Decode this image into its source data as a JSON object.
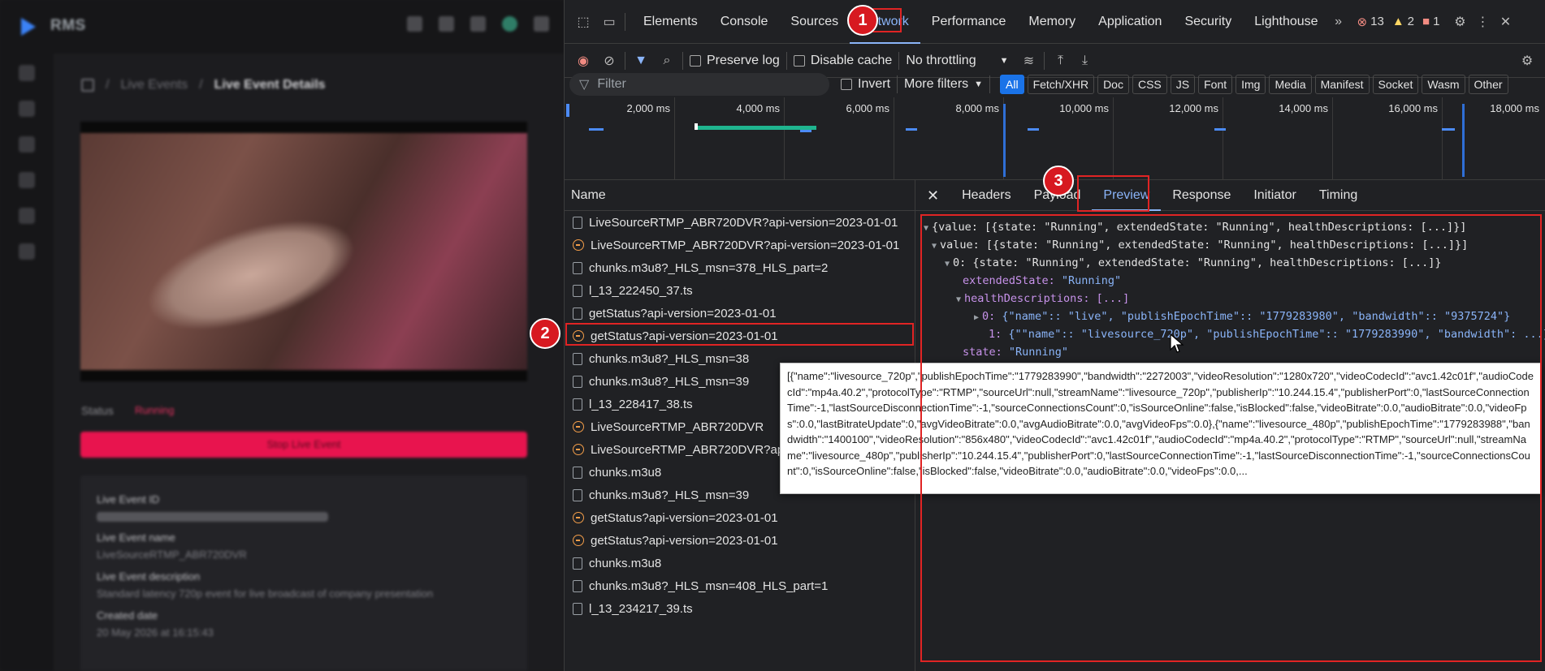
{
  "app": {
    "logo_text": "RMS",
    "breadcrumb": {
      "parent": "Live Events",
      "current": "Live Event Details"
    },
    "status_label": "Status",
    "status_value": "Running",
    "stop_button": "Stop Live Event",
    "details": {
      "id_label": "Live Event ID",
      "name_label": "Live Event name",
      "name_value": "LiveSourceRTMP_ABR720DVR",
      "description_label": "Live Event description",
      "description_value": "Standard latency 720p event for live broadcast of company presentation",
      "created_label": "Created date",
      "created_value": "20 May 2026 at 16:15:43"
    }
  },
  "devtools": {
    "tabs": [
      "Elements",
      "Console",
      "Sources",
      "Network",
      "Performance",
      "Memory",
      "Application",
      "Security",
      "Lighthouse"
    ],
    "active_tab": "Network",
    "counts": {
      "errors": "13",
      "warnings": "2",
      "info": "1"
    },
    "toolbar": {
      "preserve_log": "Preserve log",
      "disable_cache": "Disable cache",
      "throttling": "No throttling"
    },
    "filter": {
      "placeholder": "Filter",
      "invert": "Invert",
      "more_filters": "More filters",
      "types": [
        "All",
        "Fetch/XHR",
        "Doc",
        "CSS",
        "JS",
        "Font",
        "Img",
        "Media",
        "Manifest",
        "Socket",
        "Wasm",
        "Other"
      ]
    },
    "timeline_ticks": [
      "2,000 ms",
      "4,000 ms",
      "6,000 ms",
      "8,000 ms",
      "10,000 ms",
      "12,000 ms",
      "14,000 ms",
      "16,000 ms",
      "18,000 ms"
    ],
    "request_list_header": "Name",
    "requests": [
      {
        "name": "LiveSourceRTMP_ABR720DVR?api-version=2023-01-01",
        "kind": "doc"
      },
      {
        "name": "LiveSourceRTMP_ABR720DVR?api-version=2023-01-01",
        "kind": "xhr"
      },
      {
        "name": "chunks.m3u8?_HLS_msn=378_HLS_part=2",
        "kind": "doc"
      },
      {
        "name": "l_13_222450_37.ts",
        "kind": "doc"
      },
      {
        "name": "getStatus?api-version=2023-01-01",
        "kind": "doc"
      },
      {
        "name": "getStatus?api-version=2023-01-01",
        "kind": "xhr"
      },
      {
        "name": "chunks.m3u8?_HLS_msn=38",
        "kind": "doc"
      },
      {
        "name": "chunks.m3u8?_HLS_msn=39",
        "kind": "doc"
      },
      {
        "name": "l_13_228417_38.ts",
        "kind": "doc"
      },
      {
        "name": "LiveSourceRTMP_ABR720DVR",
        "kind": "xhr"
      },
      {
        "name": "LiveSourceRTMP_ABR720DVR?api",
        "kind": "xhr"
      },
      {
        "name": "chunks.m3u8",
        "kind": "doc"
      },
      {
        "name": "chunks.m3u8?_HLS_msn=39",
        "kind": "doc"
      },
      {
        "name": "getStatus?api-version=2023-01-01",
        "kind": "xhr"
      },
      {
        "name": "getStatus?api-version=2023-01-01",
        "kind": "xhr"
      },
      {
        "name": "chunks.m3u8",
        "kind": "doc"
      },
      {
        "name": "chunks.m3u8?_HLS_msn=408_HLS_part=1",
        "kind": "doc"
      },
      {
        "name": "l_13_234217_39.ts",
        "kind": "doc"
      }
    ],
    "detail_tabs": [
      "Headers",
      "Payload",
      "Preview",
      "Response",
      "Initiator",
      "Timing"
    ],
    "active_detail_tab": "Preview",
    "preview_lines": {
      "l1": "{value: [{state: \"Running\", extendedState: \"Running\", healthDescriptions: [...]}]",
      "l2": "value: [{state: \"Running\", extendedState: \"Running\", healthDescriptions: [...]}]",
      "l3": "0: {state: \"Running\", extendedState: \"Running\", healthDescriptions: [...]}",
      "l4_key": "extendedState: ",
      "l4_val": "\"Running\"",
      "l5": "healthDescriptions: [...]",
      "l6_idx": "0: ",
      "l6_body": "{\"name\":: \"live\", \"publishEpochTime\":: \"1779283980\", \"bandwidth\":: \"9375724\"}",
      "l7_idx": "1: ",
      "l7_body": "{\"\"name\":: \"livesource_720p\", \"publishEpochTime\":: \"1779283990\", \"bandwidth\": ...}",
      "l8_key": "state: ",
      "l8_val": "\"Running\""
    },
    "tooltip": "[{\"name\":\"livesource_720p\",\"publishEpochTime\":\"1779283990\",\"bandwidth\":\"2272003\",\"videoResolution\":\"1280x720\",\"videoCodecId\":\"avc1.42c01f\",\"audioCodecId\":\"mp4a.40.2\",\"protocolType\":\"RTMP\",\"sourceUrl\":null,\"streamName\":\"livesource_720p\",\"publisherIp\":\"10.244.15.4\",\"publisherPort\":0,\"lastSourceConnectionTime\":-1,\"lastSourceDisconnectionTime\":-1,\"sourceConnectionsCount\":0,\"isSourceOnline\":false,\"isBlocked\":false,\"videoBitrate\":0.0,\"audioBitrate\":0.0,\"videoFps\":0.0,\"lastBitrateUpdate\":0,\"avgVideoBitrate\":0.0,\"avgAudioBitrate\":0.0,\"avgVideoFps\":0.0},{\"name\":\"livesource_480p\",\"publishEpochTime\":\"1779283988\",\"bandwidth\":\"1400100\",\"videoResolution\":\"856x480\",\"videoCodecId\":\"avc1.42c01f\",\"audioCodecId\":\"mp4a.40.2\",\"protocolType\":\"RTMP\",\"sourceUrl\":null,\"streamName\":\"livesource_480p\",\"publisherIp\":\"10.244.15.4\",\"publisherPort\":0,\"lastSourceConnectionTime\":-1,\"lastSourceDisconnectionTime\":-1,\"sourceConnectionsCount\":0,\"isSourceOnline\":false,\"isBlocked\":false,\"videoBitrate\":0.0,\"audioBitrate\":0.0,\"videoFps\":0.0,...",
    "annotations": [
      "1",
      "2",
      "3"
    ]
  },
  "colors": {
    "accent": "#8ab4f8",
    "annotation_red": "#d71920",
    "stop_button": "#e8144e"
  }
}
